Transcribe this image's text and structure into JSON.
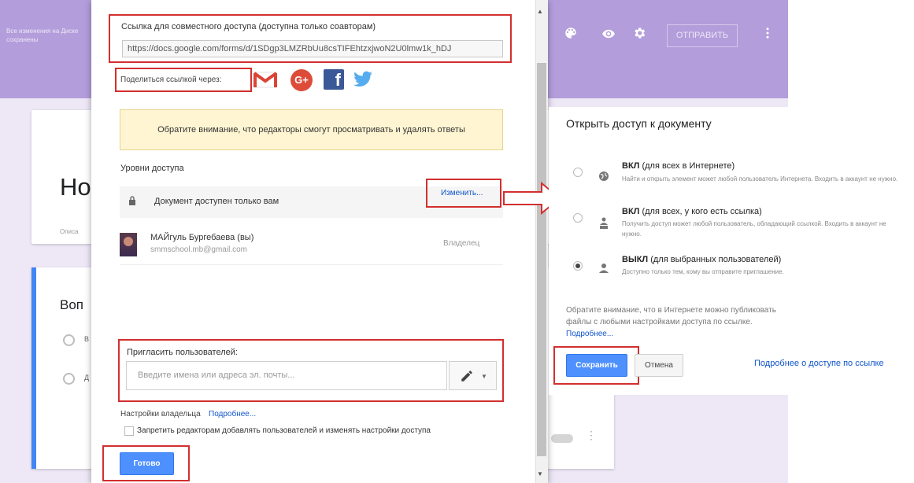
{
  "background": {
    "saved_notice": "Все изменения на Диске сохранены",
    "form_title": "Но",
    "form_desc": "Описа",
    "question_title": "Воп",
    "radio_1_label": "В",
    "radio_2_label": "Д",
    "send_button": "ОТПРАВИТЬ",
    "header_icons": [
      "palette-icon",
      "eye-icon",
      "gear-icon",
      "more-vert-icon"
    ]
  },
  "dialog": {
    "link_label": "Ссылка для совместного доступа (доступна только соавторам)",
    "link_value": "https://docs.google.com/forms/d/1SDgp3LMZRbUu8csTIFEhtzxjwoN2U0lmw1k_hDJ",
    "share_label": "Поделиться ссылкой через:",
    "share_services": [
      "Gmail",
      "Google+",
      "Facebook",
      "Twitter"
    ],
    "gplus_glyph": "G+",
    "fb_glyph": "f",
    "notice": "Обратите внимание, что редакторы смогут просматривать и удалять ответы",
    "access_levels_label": "Уровни доступа",
    "access_level_text": "Документ доступен только вам",
    "change_link": "Изменить...",
    "owner": {
      "name": "МАЙгуль Бургебаева (вы)",
      "email": "smmschool.mb@gmail.com",
      "role": "Владелец"
    },
    "invite_label": "Пригласить пользователей:",
    "invite_placeholder": "Введите имена или адреса эл. почты...",
    "owner_settings_label": "Настройки владельца",
    "owner_settings_more": "Подробнее...",
    "restrict_label": "Запретить редакторам добавлять пользователей и изменять настройки доступа",
    "done_button": "Готово"
  },
  "panel": {
    "title": "Открыть доступ к документу",
    "options": [
      {
        "title_bold": "ВКЛ",
        "title_rest": " (для всех в Интернете)",
        "desc": "Найти и открыть элемент может любой пользователь Интернета. Входить в аккаунт не нужно.",
        "selected": false,
        "icon": "globe-icon"
      },
      {
        "title_bold": "ВКЛ",
        "title_rest": " (для всех, у кого есть ссылка)",
        "desc": "Получить доступ может любой пользователь, обладающий ссылкой. Входить в аккаунт не нужно.",
        "selected": false,
        "icon": "link-people-icon"
      },
      {
        "title_bold": "ВЫКЛ",
        "title_rest": " (для выбранных пользователей)",
        "desc": "Доступно только тем, кому вы отправите приглашение.",
        "selected": true,
        "icon": "person-icon"
      }
    ],
    "note": "Обратите внимание, что в Интернете можно публиковать файлы с любыми настройками доступа по ссылке.",
    "note_link": "Подробнее...",
    "save_button": "Сохранить",
    "cancel_button": "Отмена",
    "more_link": "Подробнее о доступе по ссылке"
  },
  "colors": {
    "header": "#b39ddb",
    "accent_blue": "#4d90fe",
    "highlight_red": "#d32f2f",
    "notice_bg": "#fff5d2"
  }
}
